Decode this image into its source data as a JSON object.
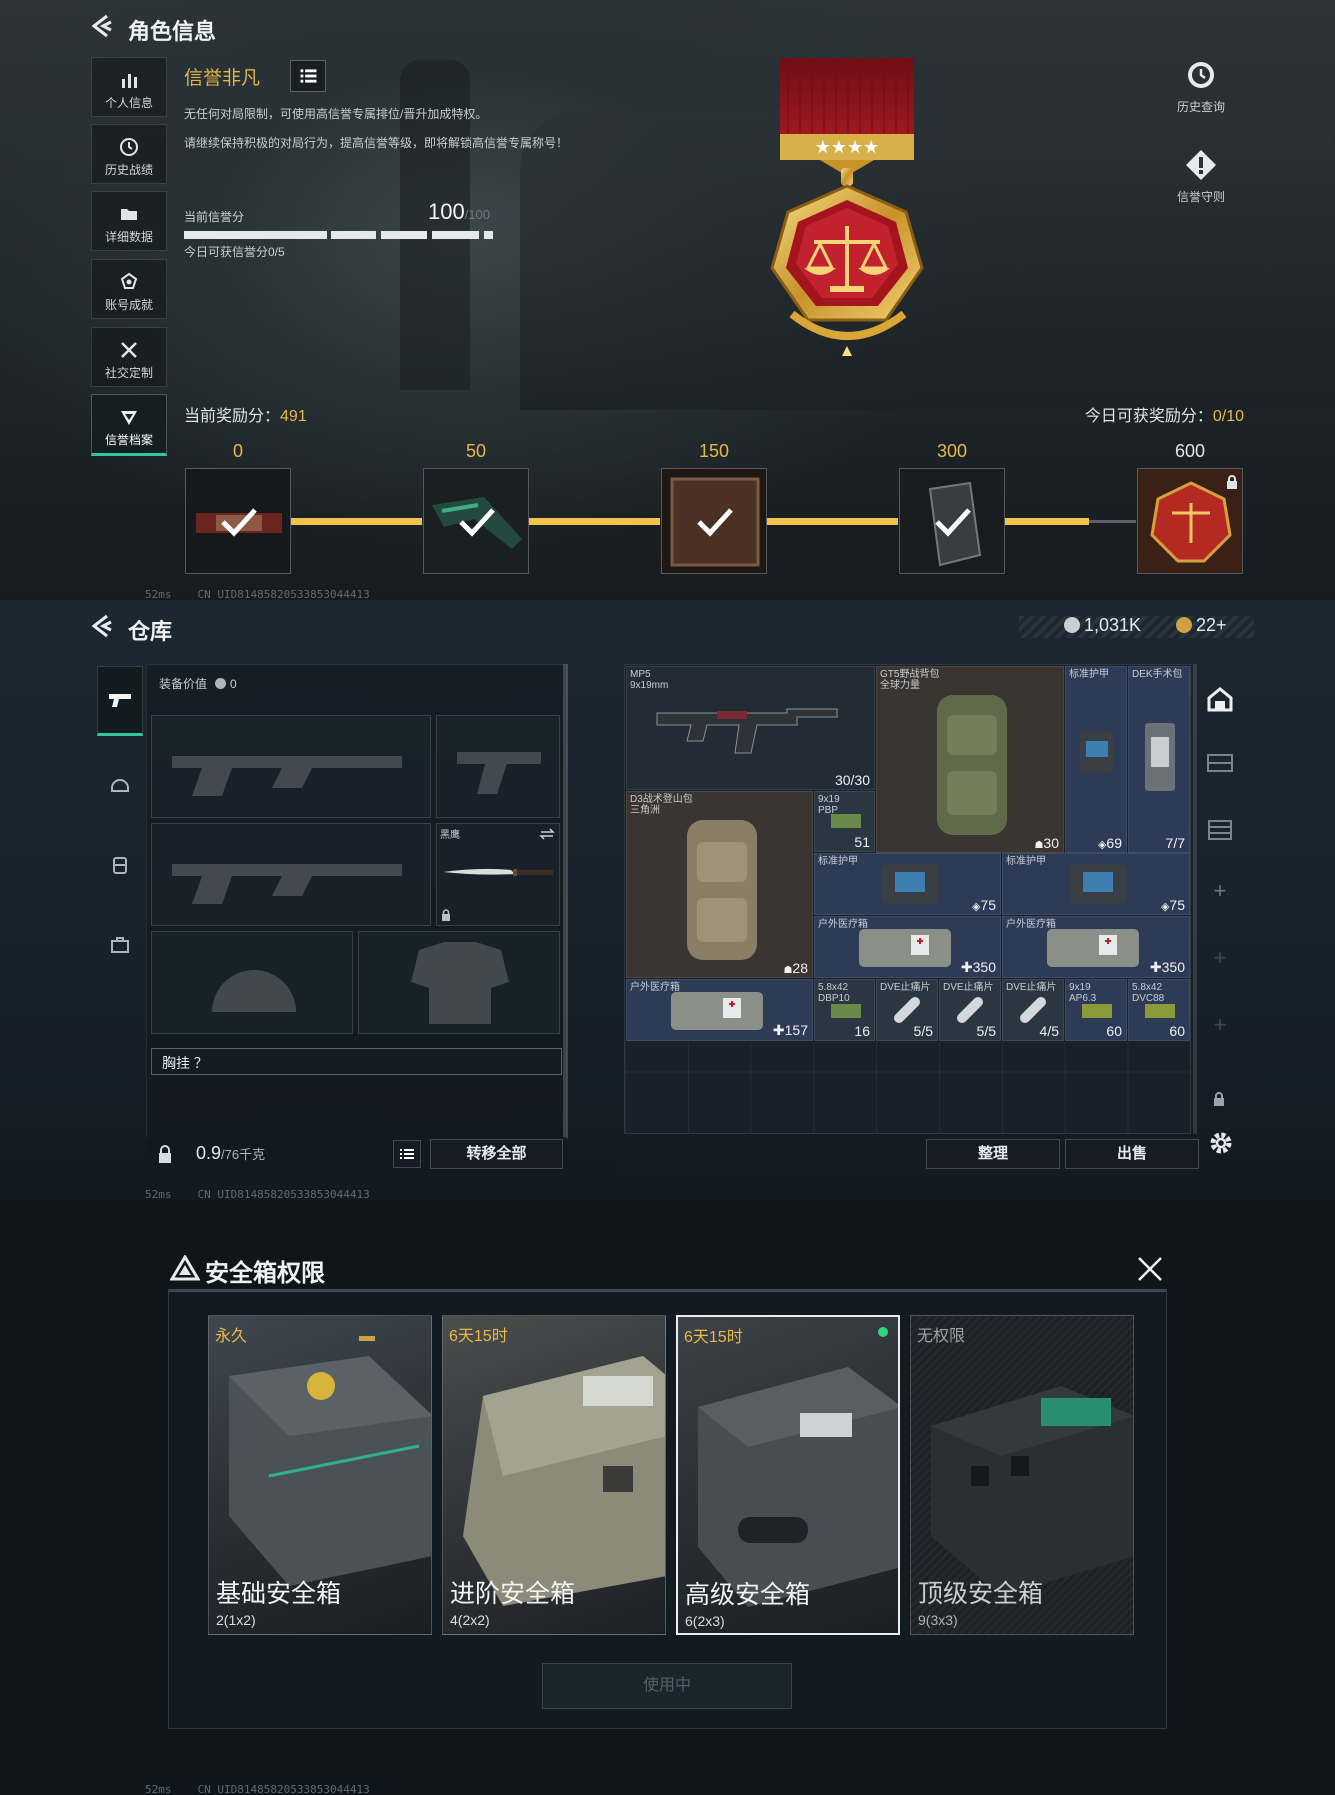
{
  "profile": {
    "title": "角色信息",
    "sidebar": [
      {
        "label": "个人信息",
        "icon": "bar-chart-icon"
      },
      {
        "label": "历史战绩",
        "icon": "history-icon"
      },
      {
        "label": "详细数据",
        "icon": "folder-icon"
      },
      {
        "label": "账号成就",
        "icon": "achievement-icon"
      },
      {
        "label": "社交定制",
        "icon": "tools-icon"
      },
      {
        "label": "信誉档案",
        "icon": "reputation-icon"
      }
    ],
    "honor_title": "信誉非凡",
    "desc1": "无任何对局限制，可使用高信誉专属排位/晋升加成特权。",
    "desc2": "请继续保持积极的对局行为，提高信誉等级，即将解锁高信誉专属称号！",
    "score_label": "当前信誉分",
    "score_value": "100",
    "score_max": "/100",
    "today_score": "今日可获信誉分0/5",
    "right_items": [
      {
        "label": "历史查询",
        "icon": "clock-history-icon"
      },
      {
        "label": "信誉守则",
        "icon": "warning-diamond-icon"
      }
    ],
    "reward_label": "当前奖励分：",
    "reward_value": "491",
    "today_reward_label": "今日可获奖励分：",
    "today_reward_value": "0/10",
    "milestones": [
      {
        "score": "0",
        "claimed": true
      },
      {
        "score": "50",
        "claimed": true
      },
      {
        "score": "150",
        "claimed": true
      },
      {
        "score": "300",
        "claimed": true
      },
      {
        "score": "600",
        "claimed": false
      }
    ],
    "status_bar": "CN UID8148582053385304441З",
    "ping": "52ms"
  },
  "warehouse": {
    "title": "仓库",
    "currency1": "1,031K",
    "currency2": "22+",
    "equip_value_label": "装备价值",
    "equip_value": "0",
    "knife_label": "黑鹰",
    "chest_rig_label": "胸挂 ？",
    "weight": "0.9",
    "weight_max": "/76千克",
    "transfer_all": "转移全部",
    "sort_button": "整理",
    "sell_button": "出售",
    "items": [
      {
        "name": "MP5\n9x19mm",
        "count": "30/30"
      },
      {
        "name": "GT5野战背包\n全球力量",
        "count": "30"
      },
      {
        "name": "标准护甲",
        "count": "69"
      },
      {
        "name": "DEK手术包",
        "count": "7/7"
      },
      {
        "name": "D3战术登山包\n三角洲",
        "count": "28"
      },
      {
        "name": "9x19\nPBP",
        "count": "51"
      },
      {
        "name": "标准护甲",
        "count": "75"
      },
      {
        "name": "标准护甲",
        "count": "75"
      },
      {
        "name": "户外医疗箱",
        "count": "350"
      },
      {
        "name": "户外医疗箱",
        "count": "350"
      },
      {
        "name": "户外医疗箱",
        "count": "157"
      },
      {
        "name": "5.8x42\nDBP10",
        "count": "16"
      },
      {
        "name": "DVE止痛片",
        "count": "5/5"
      },
      {
        "name": "DVE止痛片",
        "count": "5/5"
      },
      {
        "name": "DVE止痛片",
        "count": "4/5"
      },
      {
        "name": "9x19\nAP6.3",
        "count": "60"
      },
      {
        "name": "5.8x42\nDVC88",
        "count": "60"
      }
    ]
  },
  "safebox": {
    "title": "安全箱权限",
    "use_button": "使用中",
    "cards": [
      {
        "time": "永久",
        "name": "基础安全箱",
        "size": "2(1x2)"
      },
      {
        "time": "6天15时",
        "name": "进阶安全箱",
        "size": "4(2x2)"
      },
      {
        "time": "6天15时",
        "name": "高级安全箱",
        "size": "6(2x3)"
      },
      {
        "time": "无权限",
        "name": "顶级安全箱",
        "size": "9(3x3)"
      }
    ]
  }
}
